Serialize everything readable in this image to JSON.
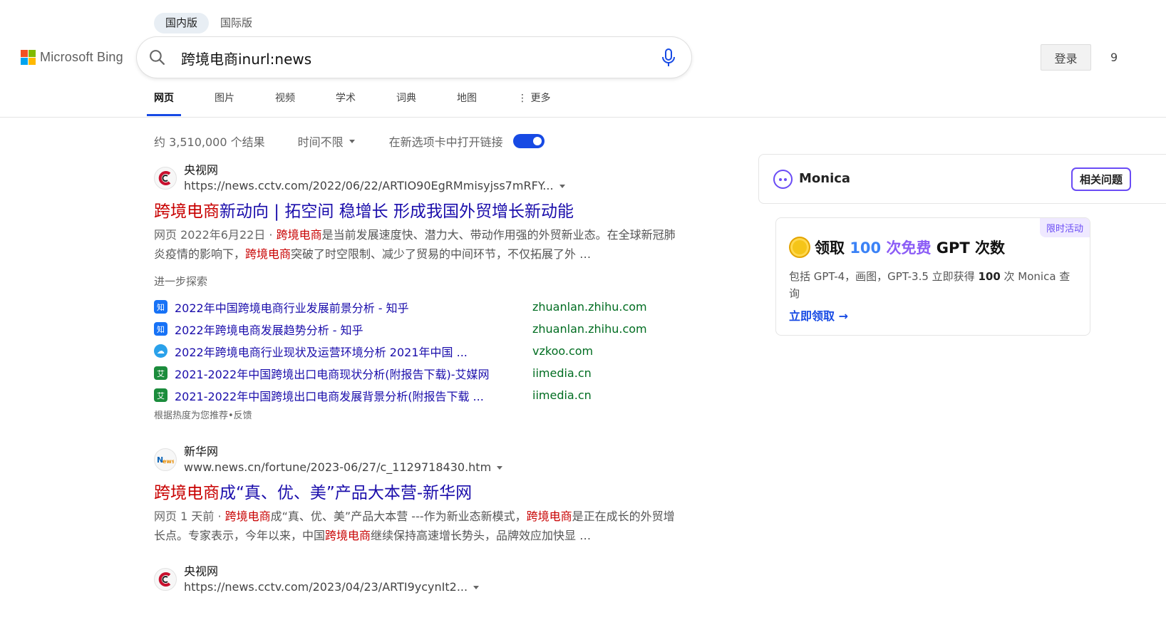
{
  "scope_tabs": [
    {
      "label": "国内版",
      "active": true
    },
    {
      "label": "国际版",
      "active": false
    }
  ],
  "logo": {
    "text": "Microsoft Bing"
  },
  "search": {
    "query": "跨境电商inurl:news"
  },
  "header": {
    "login_label": "登录",
    "reward_count": "9"
  },
  "nav": {
    "items": [
      "网页",
      "图片",
      "视频",
      "学术",
      "词典",
      "地图"
    ],
    "more_label": "⋮ 更多"
  },
  "filters": {
    "result_count": "约 3,510,000 个结果",
    "time_label": "时间不限",
    "newtab_label": "在新选项卡中打开链接"
  },
  "results": [
    {
      "site_name": "央视网",
      "url": "https://news.cctv.com/2022/06/22/ARTIO90EgRMmisyjss7mRFY...",
      "title_hl": "跨境电商",
      "title_rest": "新动向 | 拓空间 稳增长 形成我国外贸增长新动能",
      "meta": "网页 2022年6月22日 · ",
      "snippet_parts": [
        "跨境电商",
        "是当前发展速度快、潜力大、带动作用强的外贸新业态。在全球新冠肺炎疫情的影响下，",
        "跨境电商",
        "突破了时空限制、减少了贸易的中间环节，不仅拓展了外 …"
      ]
    },
    {
      "site_name": "新华网",
      "url": "www.news.cn/fortune/2023-06/27/c_1129718430.htm",
      "title_hl": "跨境电商",
      "title_rest": "成“真、优、美”产品大本营-新华网",
      "meta": "网页 1 天前 · ",
      "snippet_parts": [
        "跨境电商",
        "成“真、优、美”产品大本营 ---作为新业态新模式，",
        "跨境电商",
        "是正在成长的外贸增长点。专家表示，今年以来，中国",
        "跨境电商",
        "继续保持高速增长势头，品牌效应加快显 …"
      ]
    },
    {
      "site_name": "央视网",
      "url": "https://news.cctv.com/2023/04/23/ARTI9ycynIt2..."
    }
  ],
  "explore": {
    "heading": "进一步探索",
    "items": [
      {
        "icon": "zhihu-icon",
        "label": "2022年中国跨境电商行业发展前景分析 - 知乎",
        "domain": "zhuanlan.zhihu.com"
      },
      {
        "icon": "zhihu-icon",
        "label": "2022年跨境电商发展趋势分析 - 知乎",
        "domain": "zhuanlan.zhihu.com"
      },
      {
        "icon": "vzkoo-icon",
        "label": "2022年跨境电商行业现状及运营环境分析 2021年中国 ...",
        "domain": "vzkoo.com"
      },
      {
        "icon": "iimedia-icon",
        "label": "2021-2022年中国跨境出口电商现状分析(附报告下载)-艾媒网",
        "domain": "iimedia.cn"
      },
      {
        "icon": "iimedia-icon",
        "label": "2021-2022年中国跨境出口电商发展背景分析(附报告下载 ...",
        "domain": "iimedia.cn"
      }
    ],
    "footer": "根据热度为您推荐•反馈"
  },
  "monica": {
    "name": "Monica",
    "related_label": "相关问题",
    "promo_tag": "限时活动",
    "promo_title_1": "领取 ",
    "promo_title_num": "100",
    "promo_title_grad": " 次免费",
    "promo_title_2": " GPT 次数",
    "promo_desc_1": "包括 GPT-4，画图，GPT-3.5 立即获得 ",
    "promo_desc_bold": "100",
    "promo_desc_2": " 次 Monica 查询",
    "promo_link": "立即领取 →"
  },
  "colors": {
    "accent": "#174ae4",
    "link": "#1a0dab",
    "highlight": "#c80000",
    "domain": "#006d21",
    "monica": "#6a4cf5"
  }
}
